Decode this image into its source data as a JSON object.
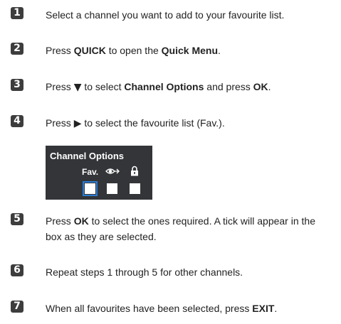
{
  "steps": [
    {
      "num": "1",
      "parts": [
        "Select a channel you want to add to your favourite list."
      ]
    },
    {
      "num": "2",
      "parts": [
        "Press ",
        "QUICK",
        " to open the ",
        "Quick Menu",
        "."
      ]
    },
    {
      "num": "3",
      "parts": [
        "Press ",
        "▼",
        " to select ",
        "Channel Options",
        " and press ",
        "OK",
        "."
      ]
    },
    {
      "num": "4",
      "parts": [
        "Press ",
        "▶",
        " to select the favourite list (Fav.)."
      ]
    },
    {
      "num": "5",
      "parts": [
        "Press ",
        "OK",
        " to select the ones required. A tick will appear in the box as they are selected."
      ]
    },
    {
      "num": "6",
      "parts": [
        "Repeat steps 1 through 5 for other channels."
      ]
    },
    {
      "num": "7",
      "parts": [
        "When all favourites have been selected, press ",
        "EXIT",
        "."
      ]
    }
  ],
  "osd": {
    "title": "Channel Options",
    "fav_label": "Fav.",
    "skip_icon": "eye-arrow-icon",
    "lock_icon": "padlock-icon",
    "highlight_color": "#2a7bd4"
  }
}
